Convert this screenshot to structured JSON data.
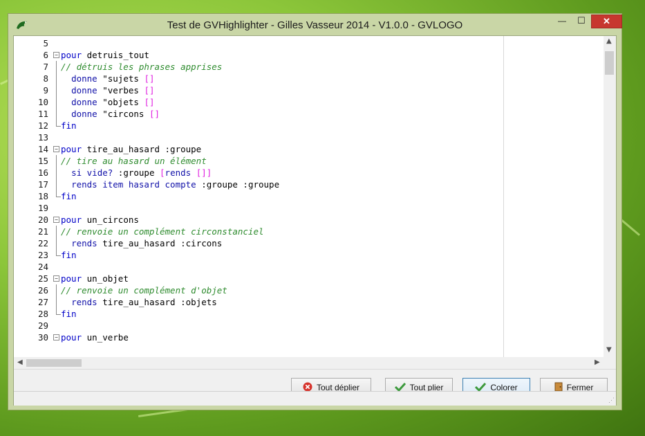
{
  "window": {
    "title": "Test de GVHighlighter - Gilles Vasseur 2014 - V1.0.0 - GVLOGO",
    "min_glyph": "—",
    "max_glyph": "☐",
    "close_glyph": "✕"
  },
  "editor": {
    "lines": [
      {
        "n": "5",
        "fold": "",
        "parts": []
      },
      {
        "n": "6",
        "fold": "start",
        "parts": [
          [
            "kw",
            "pour"
          ],
          [
            "t",
            " detruis_tout"
          ]
        ]
      },
      {
        "n": "7",
        "fold": "line",
        "parts": [
          [
            "cm",
            "// détruis les phrases apprises"
          ]
        ]
      },
      {
        "n": "8",
        "fold": "line",
        "parts": [
          [
            "t",
            "  "
          ],
          [
            "pr",
            "donne"
          ],
          [
            "t",
            " \"sujets "
          ],
          [
            "br",
            "[]"
          ]
        ]
      },
      {
        "n": "9",
        "fold": "line",
        "parts": [
          [
            "t",
            "  "
          ],
          [
            "pr",
            "donne"
          ],
          [
            "t",
            " \"verbes "
          ],
          [
            "br",
            "[]"
          ]
        ]
      },
      {
        "n": "10",
        "fold": "line",
        "parts": [
          [
            "t",
            "  "
          ],
          [
            "pr",
            "donne"
          ],
          [
            "t",
            " \"objets "
          ],
          [
            "br",
            "[]"
          ]
        ]
      },
      {
        "n": "11",
        "fold": "line",
        "parts": [
          [
            "t",
            "  "
          ],
          [
            "pr",
            "donne"
          ],
          [
            "t",
            " \"circons "
          ],
          [
            "br",
            "[]"
          ]
        ]
      },
      {
        "n": "12",
        "fold": "end",
        "parts": [
          [
            "kw",
            "fin"
          ]
        ]
      },
      {
        "n": "13",
        "fold": "",
        "parts": []
      },
      {
        "n": "14",
        "fold": "start",
        "parts": [
          [
            "kw",
            "pour"
          ],
          [
            "t",
            " tire_au_hasard :groupe"
          ]
        ]
      },
      {
        "n": "15",
        "fold": "line",
        "parts": [
          [
            "cm",
            "// tire au hasard un élément"
          ]
        ]
      },
      {
        "n": "16",
        "fold": "line",
        "parts": [
          [
            "t",
            "  "
          ],
          [
            "pr",
            "si vide?"
          ],
          [
            "t",
            " :groupe "
          ],
          [
            "br",
            "["
          ],
          [
            "pr",
            "rends"
          ],
          [
            "t",
            " "
          ],
          [
            "br",
            "[]]"
          ]
        ]
      },
      {
        "n": "17",
        "fold": "line",
        "parts": [
          [
            "t",
            "  "
          ],
          [
            "pr",
            "rends item hasard compte"
          ],
          [
            "t",
            " :groupe :groupe"
          ]
        ]
      },
      {
        "n": "18",
        "fold": "end",
        "parts": [
          [
            "kw",
            "fin"
          ]
        ]
      },
      {
        "n": "19",
        "fold": "",
        "parts": []
      },
      {
        "n": "20",
        "fold": "start",
        "parts": [
          [
            "kw",
            "pour"
          ],
          [
            "t",
            " un_circons"
          ]
        ]
      },
      {
        "n": "21",
        "fold": "line",
        "parts": [
          [
            "cm",
            "// renvoie un complément circonstanciel"
          ]
        ]
      },
      {
        "n": "22",
        "fold": "line",
        "parts": [
          [
            "t",
            "  "
          ],
          [
            "pr",
            "rends"
          ],
          [
            "t",
            " tire_au_hasard :circons"
          ]
        ]
      },
      {
        "n": "23",
        "fold": "end",
        "parts": [
          [
            "kw",
            "fin"
          ]
        ]
      },
      {
        "n": "24",
        "fold": "",
        "parts": []
      },
      {
        "n": "25",
        "fold": "start",
        "parts": [
          [
            "kw",
            "pour"
          ],
          [
            "t",
            " un_objet"
          ]
        ]
      },
      {
        "n": "26",
        "fold": "line",
        "parts": [
          [
            "cm",
            "// renvoie un complément d'objet"
          ]
        ]
      },
      {
        "n": "27",
        "fold": "line",
        "parts": [
          [
            "t",
            "  "
          ],
          [
            "pr",
            "rends"
          ],
          [
            "t",
            " tire_au_hasard :objets"
          ]
        ]
      },
      {
        "n": "28",
        "fold": "end",
        "parts": [
          [
            "kw",
            "fin"
          ]
        ]
      },
      {
        "n": "29",
        "fold": "",
        "parts": []
      },
      {
        "n": "30",
        "fold": "start",
        "parts": [
          [
            "kw",
            "pour"
          ],
          [
            "t",
            " un_verbe"
          ]
        ]
      }
    ]
  },
  "buttons": {
    "unfold": "Tout déplier",
    "fold": "Tout plier",
    "color": "Colorer",
    "close": "Fermer"
  },
  "colors": {
    "keyword": "#0000c8",
    "primitive": "#1010a8",
    "comment": "#2e8b2e",
    "bracket": "#e020e0",
    "close_button": "#c7372f"
  }
}
